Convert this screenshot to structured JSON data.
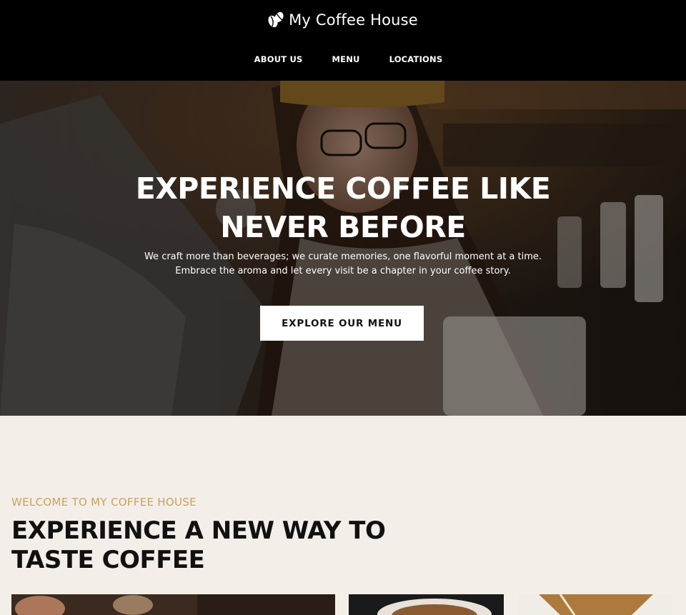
{
  "header": {
    "brand": "My Coffee House",
    "brand_icon": "coffee-beans-icon",
    "nav": [
      "ABOUT US",
      "MENU",
      "LOCATIONS"
    ]
  },
  "hero": {
    "title_line1": "EXPERIENCE COFFEE LIKE",
    "title_line2": "NEVER BEFORE",
    "subtitle_line1": "We craft more than beverages; we curate memories, one flavorful moment at a time.",
    "subtitle_line2": "Embrace the aroma and let every visit be a chapter in your coffee story.",
    "cta_label": "EXPLORE OUR MENU"
  },
  "welcome": {
    "eyebrow": "WELCOME TO MY COFFEE HOUSE",
    "title_line1": "EXPERIENCE A NEW WAY TO",
    "title_line2": "TASTE COFFEE"
  },
  "colors": {
    "header_bg": "#000000",
    "page_bg": "#f3efe8",
    "accent": "#c9a063"
  }
}
